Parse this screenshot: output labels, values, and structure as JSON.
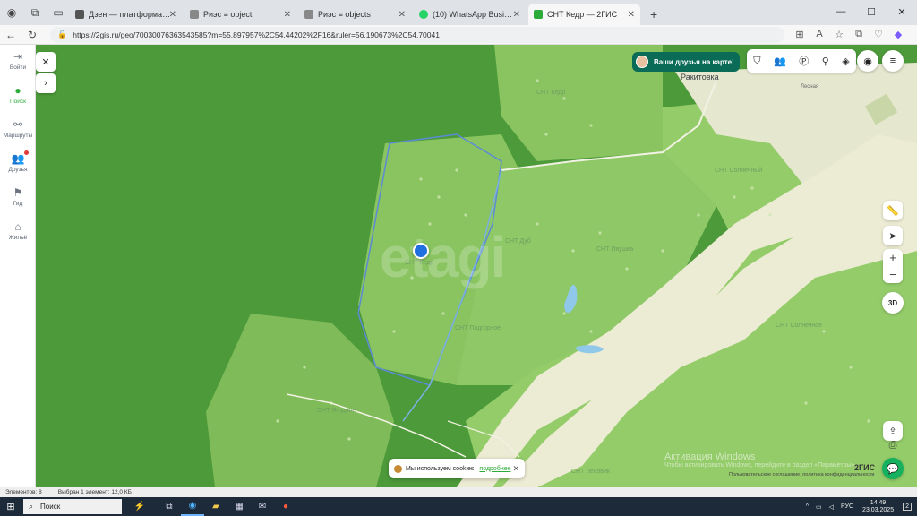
{
  "browser": {
    "tabs": [
      {
        "label": "Дзен — платформа для просмо",
        "color": "#555555",
        "active": false
      },
      {
        "label": "Риэс ≡ object",
        "color": "#7a7a7a",
        "active": false
      },
      {
        "label": "Риэс ≡ objects",
        "color": "#7a7a7a",
        "active": false
      },
      {
        "label": "(10) WhatsApp Business",
        "color": "#25d366",
        "active": false
      },
      {
        "label": "СНТ Кедр — 2ГИС",
        "color": "#2dab3a",
        "active": true
      }
    ],
    "url": "https://2gis.ru/geo/70030076363543585?m=55.897957%2C54.44202%2F16&ruler=56.190673%2C54.70041"
  },
  "sidebar": {
    "items": [
      {
        "label": "Войти",
        "icon": "login-icon"
      },
      {
        "label": "Поиск",
        "icon": "search-pin-icon"
      },
      {
        "label": "Маршруты",
        "icon": "routes-icon"
      },
      {
        "label": "Друзья",
        "icon": "friends-icon"
      },
      {
        "label": "Гид",
        "icon": "flag-icon"
      },
      {
        "label": "Жильё",
        "icon": "house-icon"
      }
    ]
  },
  "map": {
    "banner": "Ваши друзья на карте!",
    "watermark": "etagi",
    "zoom_in": "+",
    "zoom_out": "−",
    "btn_3d": "3D",
    "labels": {
      "town": "Ракитовка",
      "street": "Лесная",
      "snt_kedr": "СНТ Кедр",
      "snt_top": "СНТ Кедр",
      "snt_east": "СНТ Солнечный",
      "snt_mid": "СНТ Дуб",
      "snt_mid2": "СНТ Ивушка",
      "snt_center": "СНТ Подгорное",
      "snt_right": "СНТ Солнечное",
      "snt_south": "СНТ Ягодное",
      "snt_bottom": "СНТ Лесовик"
    },
    "cookie": {
      "text": "Мы используем cookies",
      "link": "подробнее"
    },
    "brand": "2ГИС",
    "legal": "Пользовательское соглашение, политика конфиденциальности",
    "windows_activation": {
      "title": "Активация Windows",
      "subtitle": "Чтобы активировать Windows, перейдите в раздел «Параметры»."
    }
  },
  "statusbar": {
    "elements": "Элементов: 8",
    "selected": "Выбран 1 элемент: 12,0 КБ"
  },
  "taskbar": {
    "search_placeholder": "Поиск",
    "language": "РУС",
    "time": "14:49",
    "date": "23.03.2025",
    "notifications": "2"
  }
}
